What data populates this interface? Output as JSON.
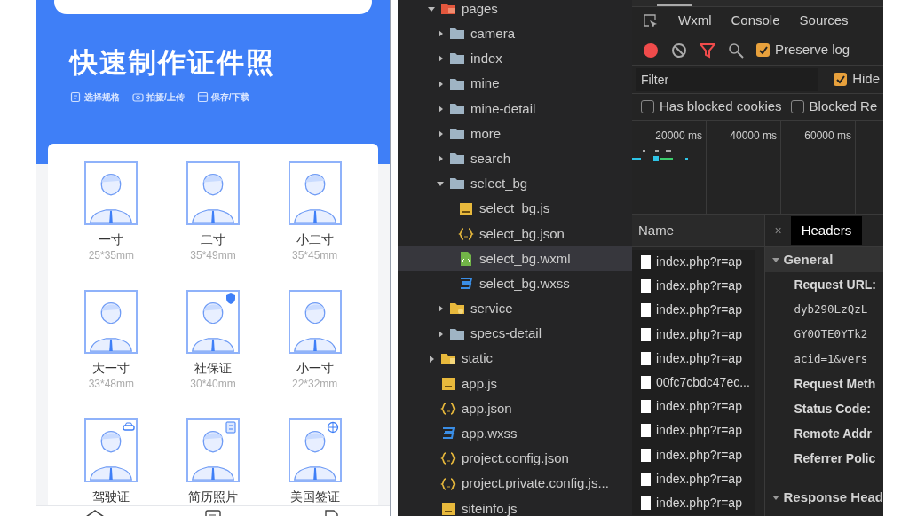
{
  "phone": {
    "title": "快速制作证件照",
    "steps": [
      {
        "kind": "spec",
        "label": "选择规格"
      },
      {
        "kind": "camera",
        "label": "拍摄/上传"
      },
      {
        "kind": "save",
        "label": "保存/下载"
      }
    ],
    "sizes": [
      {
        "name": "一寸",
        "size": "25*35mm",
        "kind": "plain"
      },
      {
        "name": "二寸",
        "size": "35*49mm",
        "kind": "plain"
      },
      {
        "name": "小二寸",
        "size": "35*45mm",
        "kind": "plain"
      },
      {
        "name": "大一寸",
        "size": "33*48mm",
        "kind": "plain"
      },
      {
        "name": "社保证",
        "size": "30*40mm",
        "kind": "shield"
      },
      {
        "name": "小一寸",
        "size": "22*32mm",
        "kind": "plain"
      },
      {
        "name": "驾驶证",
        "kind": "car"
      },
      {
        "name": "简历照片",
        "kind": "card"
      },
      {
        "name": "美国签证",
        "kind": "globe"
      }
    ],
    "tab_bar": [
      {
        "kind": "home"
      },
      {
        "kind": "list"
      },
      {
        "kind": "doc"
      }
    ]
  },
  "file_tree": [
    {
      "label": "pages",
      "kind": "pages",
      "expanded": true,
      "selected": false,
      "children": [
        {
          "label": "camera",
          "kind": "folder",
          "expanded": false,
          "selected": false
        },
        {
          "label": "index",
          "kind": "folder",
          "expanded": false,
          "selected": false
        },
        {
          "label": "mine",
          "kind": "folder",
          "expanded": false,
          "selected": false
        },
        {
          "label": "mine-detail",
          "kind": "folder",
          "expanded": false,
          "selected": false
        },
        {
          "label": "more",
          "kind": "folder",
          "expanded": false,
          "selected": false
        },
        {
          "label": "search",
          "kind": "folder",
          "expanded": false,
          "selected": false
        },
        {
          "label": "select_bg",
          "kind": "folder",
          "expanded": true,
          "selected": false,
          "children": [
            {
              "label": "select_bg.js",
              "kind": "js",
              "selected": false
            },
            {
              "label": "select_bg.json",
              "kind": "json",
              "selected": false
            },
            {
              "label": "select_bg.wxml",
              "kind": "wxml",
              "selected": true
            },
            {
              "label": "select_bg.wxss",
              "kind": "wxss",
              "selected": false
            }
          ]
        },
        {
          "label": "service",
          "kind": "service",
          "expanded": false,
          "selected": false
        },
        {
          "label": "specs-detail",
          "kind": "folder",
          "expanded": false,
          "selected": false
        }
      ]
    },
    {
      "label": "static",
      "kind": "static",
      "expanded": false,
      "selected": false
    },
    {
      "label": "app.js",
      "kind": "js",
      "selected": false
    },
    {
      "label": "app.json",
      "kind": "json",
      "selected": false
    },
    {
      "label": "app.wxss",
      "kind": "wxss",
      "selected": false
    },
    {
      "label": "project.config.json",
      "kind": "json",
      "selected": false
    },
    {
      "label": "project.private.config.js...",
      "kind": "json",
      "selected": false
    },
    {
      "label": "siteinfo.js",
      "kind": "js",
      "selected": false
    }
  ],
  "devtools": {
    "tabs": [
      {
        "label": "Wxml",
        "selected": false
      },
      {
        "label": "Console",
        "selected": false
      },
      {
        "label": "Sources",
        "selected": false
      }
    ],
    "preserve_log": {
      "label": "Preserve log",
      "checked": true
    },
    "filter": {
      "placeholder": "Filter"
    },
    "hide": {
      "label": "Hide",
      "checked": true
    },
    "options": [
      {
        "label": "Has blocked cookies",
        "checked": false
      },
      {
        "label": "Blocked Re",
        "checked": false
      }
    ],
    "timeline_ticks": [
      "20000 ms",
      "40000 ms",
      "60000 ms"
    ],
    "name_header": "Name",
    "requests": [
      "index.php?r=ap",
      "index.php?r=ap",
      "index.php?r=ap",
      "index.php?r=ap",
      "index.php?r=ap",
      "00fc7cbdc47ec...",
      "index.php?r=ap",
      "index.php?r=ap",
      "index.php?r=ap",
      "index.php?r=ap",
      "index.php?r=ap"
    ],
    "detail_close": "×",
    "detail_tab": {
      "label": "Headers",
      "selected": true
    },
    "sections": [
      {
        "title": "General",
        "expanded": true,
        "lines": [
          {
            "kind": "key",
            "text": "Request URL:"
          },
          {
            "kind": "value",
            "text": "dyb290LzQzL"
          },
          {
            "kind": "value",
            "text": "GY0OTE0YTk2"
          },
          {
            "kind": "value",
            "text": "acid=1&vers"
          },
          {
            "kind": "key",
            "text": "Request Meth"
          },
          {
            "kind": "key",
            "text": "Status Code:"
          },
          {
            "kind": "key",
            "text": "Remote Addr"
          },
          {
            "kind": "key",
            "text": "Referrer Polic"
          }
        ]
      },
      {
        "title": "Response Head",
        "expanded": true
      }
    ]
  }
}
